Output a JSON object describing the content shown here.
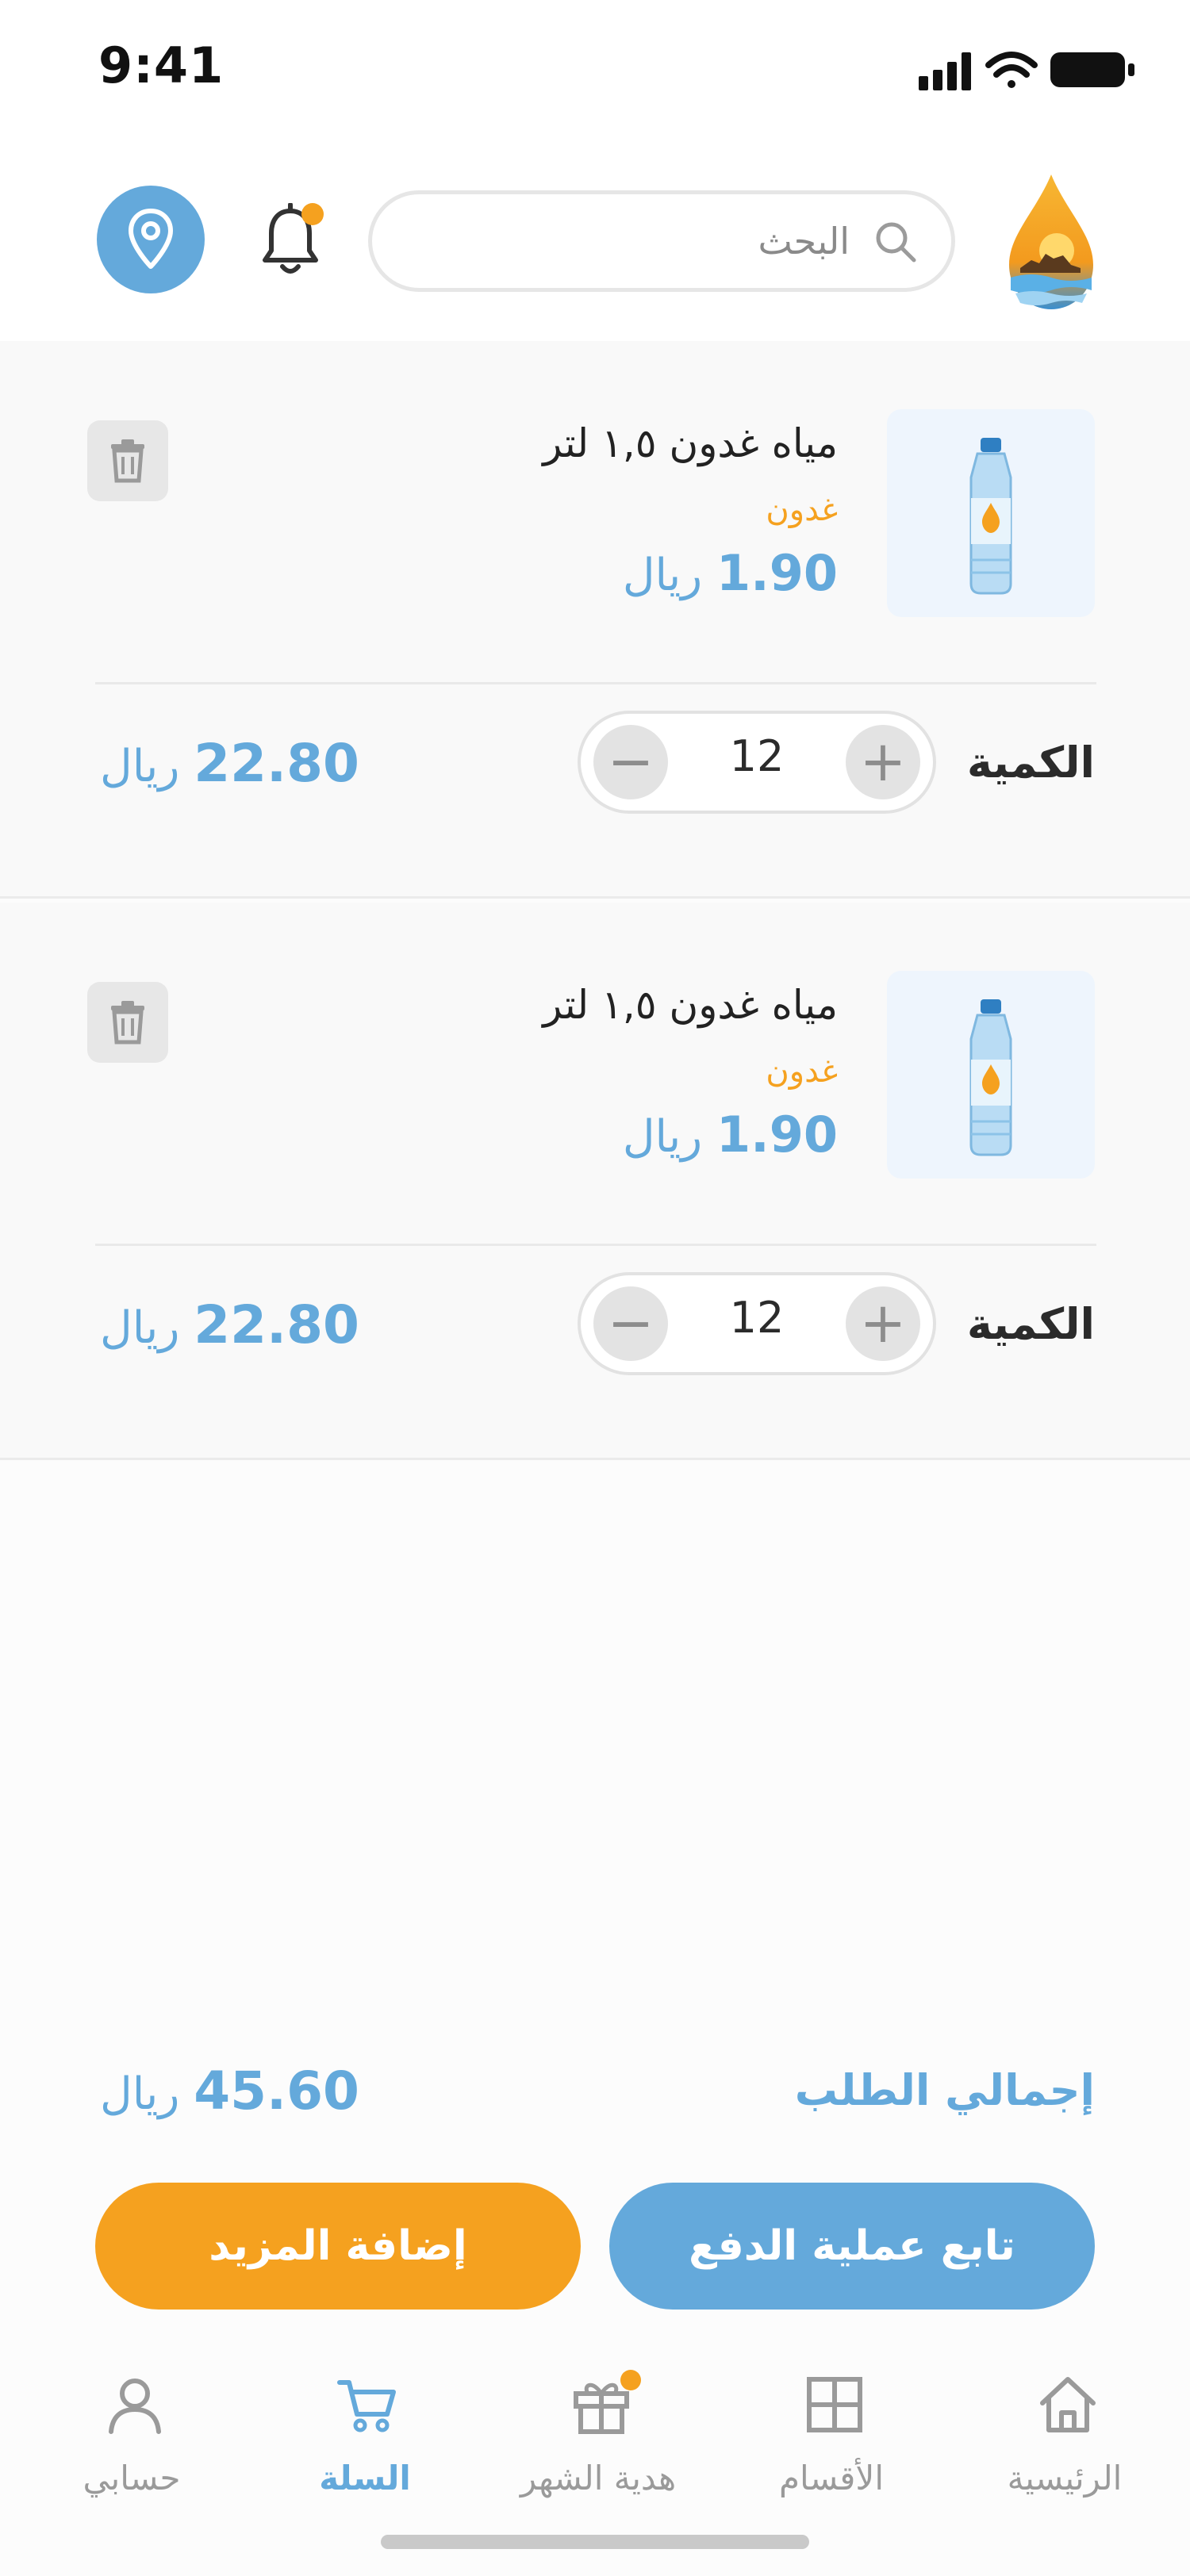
{
  "status_bar": {
    "time": "9:41"
  },
  "header": {
    "search_placeholder": "البحث"
  },
  "cart": {
    "items": [
      {
        "name": "مياه غدون ١,٥ لتر",
        "brand": "غدون",
        "unit_price": "1.90",
        "currency": "ريال",
        "quantity_label": "الكمية",
        "quantity": "12",
        "line_total": "22.80"
      },
      {
        "name": "مياه غدون ١,٥ لتر",
        "brand": "غدون",
        "unit_price": "1.90",
        "currency": "ريال",
        "quantity_label": "الكمية",
        "quantity": "12",
        "line_total": "22.80"
      }
    ]
  },
  "summary": {
    "total_label": "إجمالي الطلب",
    "total_value": "45.60",
    "currency": "ريال"
  },
  "actions": {
    "checkout_label": "تابع عملية الدفع",
    "add_more_label": "إضافة المزيد"
  },
  "bottom_nav": {
    "items": [
      {
        "label": "الرئيسية",
        "icon": "home-icon"
      },
      {
        "label": "الأقسام",
        "icon": "grid-icon"
      },
      {
        "label": "هدية الشهر",
        "icon": "gift-icon"
      },
      {
        "label": "السلة",
        "icon": "cart-icon"
      },
      {
        "label": "حسابي",
        "icon": "user-icon"
      }
    ],
    "active": "السلة"
  },
  "colors": {
    "primary_blue": "#64a9db",
    "accent_orange": "#f5a11f",
    "background": "#fcfcfc"
  }
}
